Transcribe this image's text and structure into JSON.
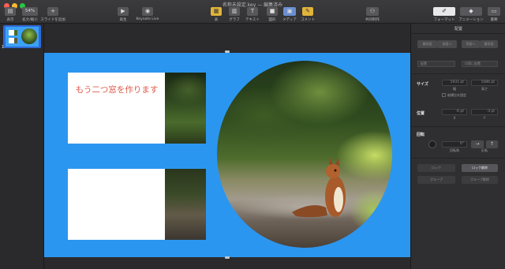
{
  "window": {
    "title": "名称未設定.key — 編集済み"
  },
  "toolbar": {
    "view_label": "表示",
    "zoom_value": "54%",
    "zoom_label": "拡大/縮小",
    "add_slide_label": "スライドを追加",
    "play_label": "再生",
    "keynote_live_label": "Keynote Live",
    "table_label": "表",
    "chart_label": "グラフ",
    "text_label": "テキスト",
    "shape_label": "図形",
    "media_label": "メディア",
    "comment_label": "コメント",
    "collaborate_label": "共同制作",
    "format_label": "フォーマット",
    "animate_label": "アニメーション",
    "document_label": "書類"
  },
  "navigator": {
    "slide_number": "1"
  },
  "slide": {
    "box_text": "もう二つ窓を作ります"
  },
  "inspector": {
    "title": "配置",
    "bring_front": "最前面",
    "bring_forward": "前面へ",
    "send_backward": "背面へ",
    "send_back": "最背面",
    "align_placeholder": "配置",
    "distribute_placeholder": "均等に配置",
    "size_label": "サイズ",
    "width_value": "1931 pt",
    "width_label": "幅",
    "height_value": "1086 pt",
    "height_label": "高さ",
    "constrain_label": "縦横比を固定",
    "position_label": "位置",
    "x_value": "-6 pt",
    "x_label": "X",
    "y_value": "-3 pt",
    "y_label": "Y",
    "rotate_label": "回転",
    "angle_value": "0°",
    "angle_label": "回転角",
    "flip_label": "反転",
    "lock_label": "ロック",
    "unlock_label": "ロック解除",
    "group_label": "グループ",
    "ungroup_label": "グループ解除"
  },
  "colors": {
    "slide_bg": "#2b96f0",
    "text_red": "#e1594a",
    "selection": "#2d6bd8"
  }
}
